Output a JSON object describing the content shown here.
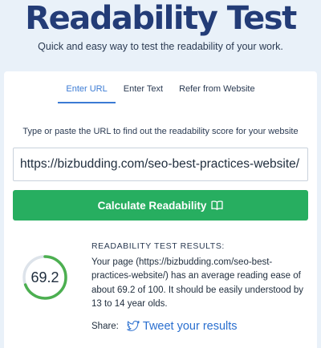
{
  "header": {
    "title": "Readability Test",
    "subtitle": "Quick and easy way to test the readability of your work."
  },
  "tabs": [
    {
      "label": "Enter URL",
      "active": true
    },
    {
      "label": "Enter Text",
      "active": false
    },
    {
      "label": "Refer from Website",
      "active": false
    }
  ],
  "form": {
    "instructions": "Type or paste the URL to find out the readability score for your website",
    "url_value": "https://bizbudding.com/seo-best-practices-website/",
    "button_label": "Calculate Readability",
    "button_icon": "book-icon"
  },
  "results": {
    "heading": "READABILITY TEST RESULTS:",
    "score": "69.2",
    "score_fraction": 0.692,
    "text": "Your page (https://bizbudding.com/seo-best-practices-website/) has an average reading ease of about 69.2 of 100. It should be easily understood by 13 to 14 year olds.",
    "share_label": "Share:",
    "tweet_label": "Tweet your results",
    "tweet_icon": "twitter-icon"
  },
  "colors": {
    "title": "#233c77",
    "accent": "#3b7bd4",
    "button": "#27ae60",
    "gauge": "#4caf50",
    "background": "#e9f1f9"
  }
}
